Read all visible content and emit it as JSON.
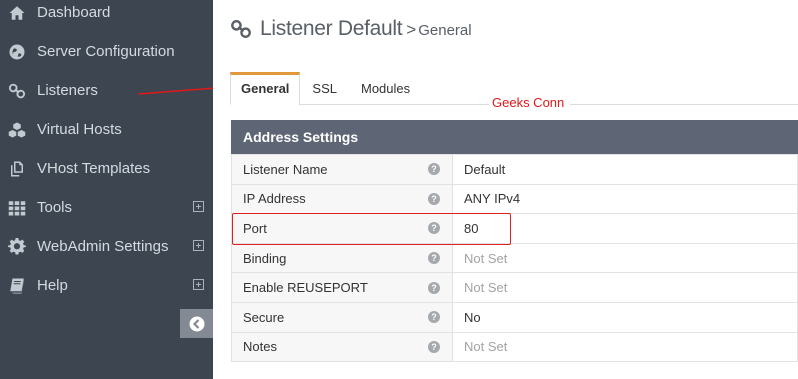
{
  "sidebar": {
    "items": [
      {
        "label": "Dashboard",
        "icon": "home-icon"
      },
      {
        "label": "Server Configuration",
        "icon": "globe-icon"
      },
      {
        "label": "Listeners",
        "icon": "link-icon"
      },
      {
        "label": "Virtual Hosts",
        "icon": "cubes-icon"
      },
      {
        "label": "VHost Templates",
        "icon": "copy-icon"
      },
      {
        "label": "Tools",
        "icon": "grid-icon",
        "expandable": true
      },
      {
        "label": "WebAdmin Settings",
        "icon": "gear-icon",
        "expandable": true
      },
      {
        "label": "Help",
        "icon": "book-icon",
        "expandable": true
      }
    ],
    "collapse_icon": "arrow-left-circle-icon"
  },
  "header": {
    "title": "Listener Default",
    "separator": ">",
    "subtitle": "General",
    "icon": "link-icon"
  },
  "tabs": [
    {
      "label": "General",
      "active": true
    },
    {
      "label": "SSL",
      "active": false
    },
    {
      "label": "Modules",
      "active": false
    }
  ],
  "annotation": {
    "label": "Geeks Conn",
    "color": "#e01818"
  },
  "panel": {
    "title": "Address Settings",
    "rows": [
      {
        "key": "Listener Name",
        "value": "Default",
        "unset": false
      },
      {
        "key": "IP Address",
        "value": "ANY IPv4",
        "unset": false
      },
      {
        "key": "Port",
        "value": "80",
        "unset": false
      },
      {
        "key": "Binding",
        "value": "Not Set",
        "unset": true
      },
      {
        "key": "Enable REUSEPORT",
        "value": "Not Set",
        "unset": true
      },
      {
        "key": "Secure",
        "value": "No",
        "unset": false
      },
      {
        "key": "Notes",
        "value": "Not Set",
        "unset": true
      }
    ]
  },
  "colors": {
    "sidebar_bg": "#3d4550",
    "panel_header_bg": "#5e6675",
    "active_tab_accent": "#e0983a",
    "highlight": "#e02020"
  }
}
